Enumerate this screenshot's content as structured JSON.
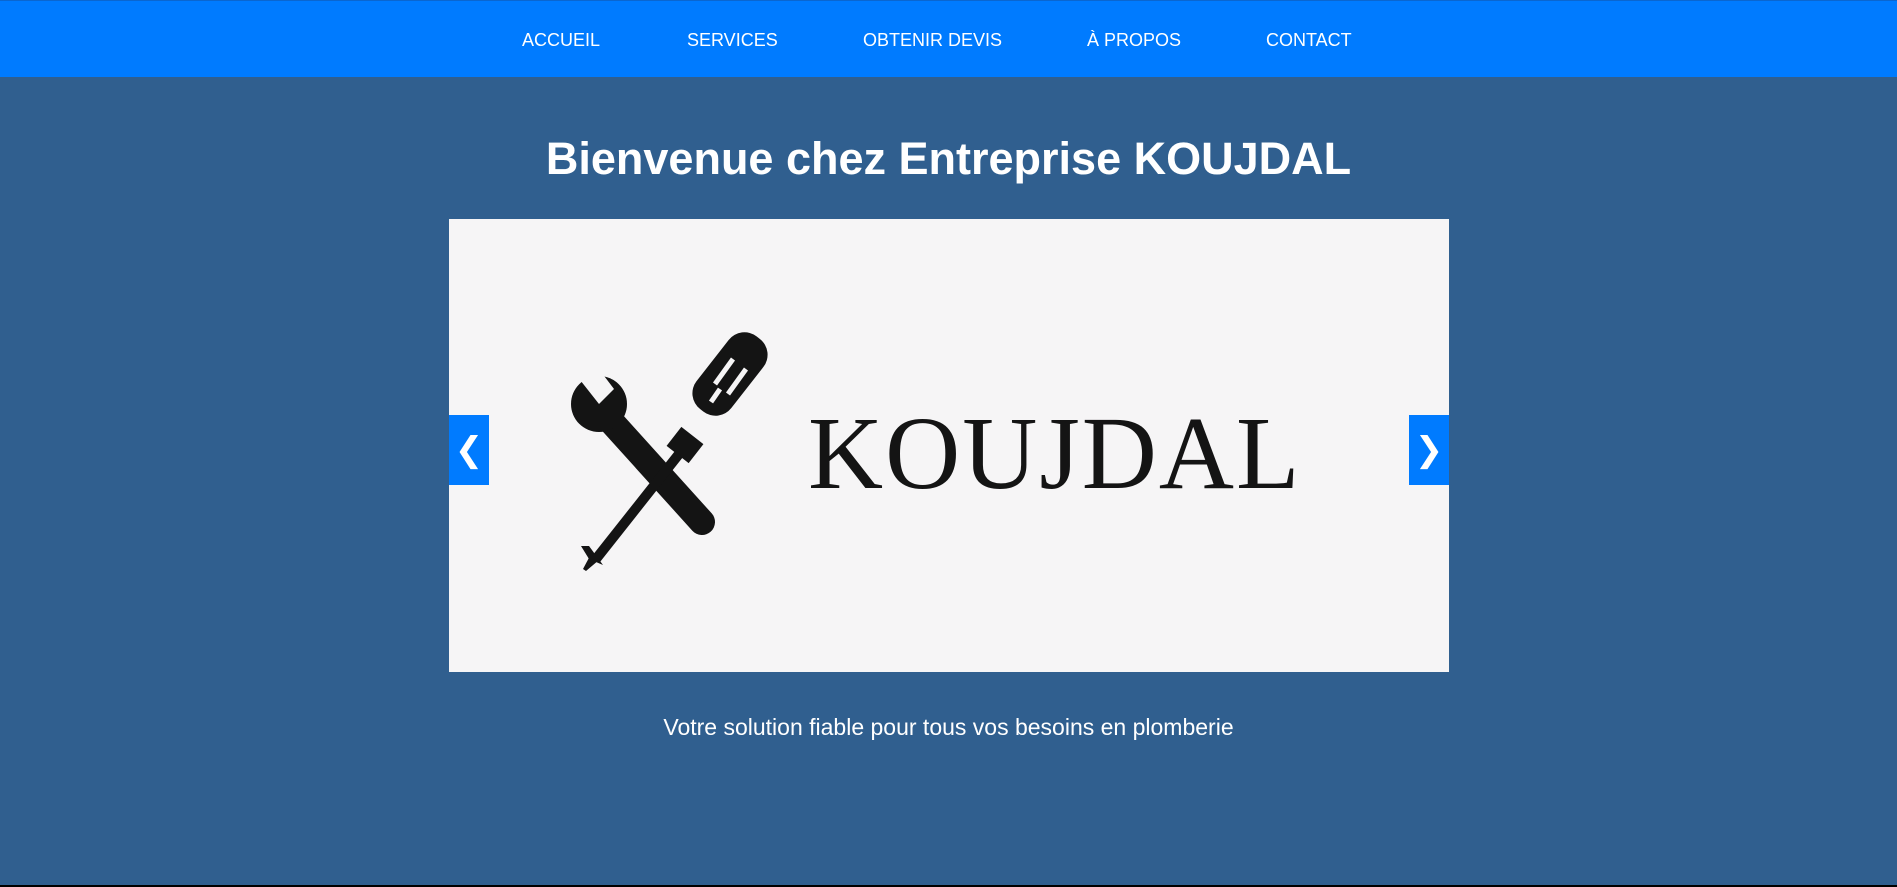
{
  "nav": {
    "items": [
      {
        "label": "ACCUEIL"
      },
      {
        "label": "SERVICES"
      },
      {
        "label": "OBTENIR DEVIS"
      },
      {
        "label": "À PROPOS"
      },
      {
        "label": "CONTACT"
      }
    ]
  },
  "hero": {
    "title": "Bienvenue chez Entreprise KOUJDAL",
    "tagline": "Votre solution fiable pour tous vos besoins en plomberie"
  },
  "slider": {
    "slide_logo_text": "KOUJDAL",
    "slide_logo_icon": "wrench-screwdriver-icon",
    "prev_label": "❮",
    "next_label": "❯"
  },
  "colors": {
    "navbar": "#007bff",
    "background": "#305f8f",
    "slider_buttons": "#007bff",
    "slide_background": "#f6f5f6",
    "logo": "#141414",
    "text": "#ffffff"
  }
}
